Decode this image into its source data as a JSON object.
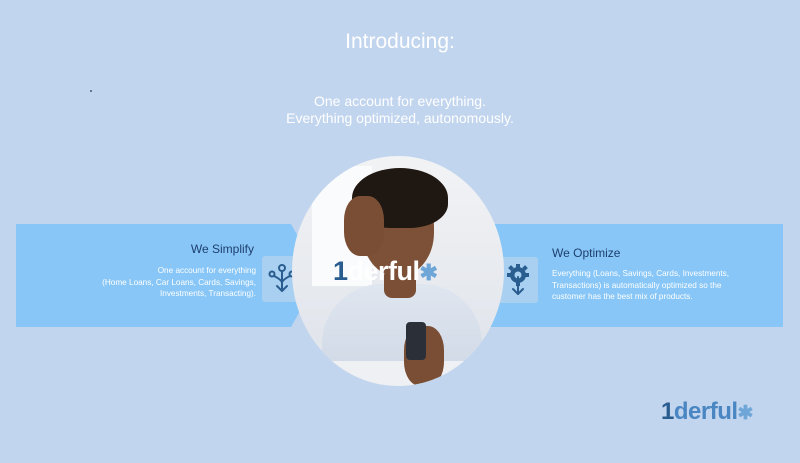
{
  "title": "Introducing:",
  "subtitle": {
    "line1": "One account for everything.",
    "line2": "Everything optimized, autonomously."
  },
  "simplify": {
    "heading": "We Simplify",
    "line1": "One account for everything",
    "line2": "(Home Loans, Car Loans, Cards, Savings,",
    "line3": "Investments, Transacting).",
    "icon": "branching-arrows-icon"
  },
  "optimize": {
    "heading": "We Optimize",
    "line1": "Everything (Loans, Savings, Cards, Investments,",
    "line2": "Transactions) is automatically optimized so the",
    "line3": "customer has the best mix of products.",
    "icon": "gear-arrow-icon"
  },
  "logo": {
    "one": "1",
    "rest": "derful"
  },
  "colors": {
    "background": "#c2d5ee",
    "band": "#87c6f7",
    "heading": "#1e3f6e",
    "brand_dark": "#2a5d8f"
  }
}
